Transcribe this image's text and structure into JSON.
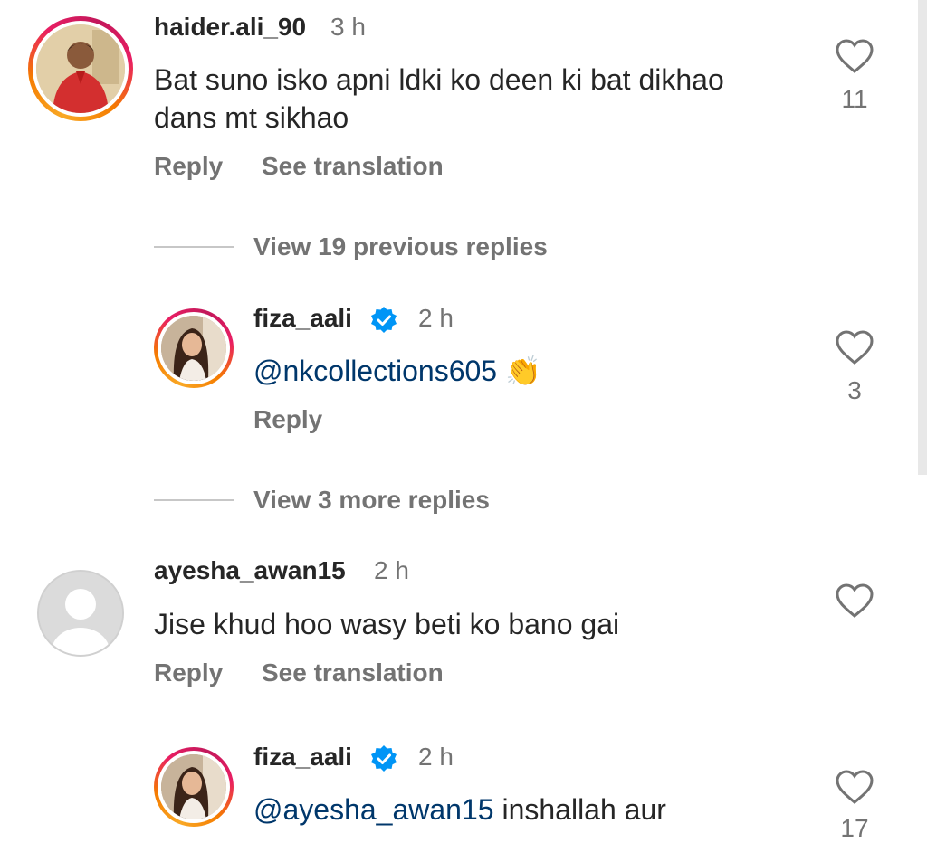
{
  "comments": [
    {
      "username": "haider.ali_90",
      "time": "3 h",
      "text_line1": "Bat suno isko apni ldki ko deen ki bat dikhao",
      "text_line2": "dans mt sikhao",
      "likes": "11",
      "reply_label": "Reply",
      "translate_label": "See translation"
    },
    {
      "view_replies_label": "View 19 previous replies"
    },
    {
      "username": "fiza_aali",
      "time": "2 h",
      "mention": "@nkcollections605",
      "emoji": "👏",
      "likes": "3",
      "reply_label": "Reply"
    },
    {
      "view_replies_label": "View 3 more replies"
    },
    {
      "username": "ayesha_awan15",
      "time": "2 h",
      "text": "Jise khud hoo wasy beti ko bano gai",
      "reply_label": "Reply",
      "translate_label": "See translation"
    },
    {
      "username": "fiza_aali",
      "time": "2 h",
      "mention": "@ayesha_awan15",
      "text": " inshallah aur",
      "likes": "17"
    }
  ],
  "icons": {
    "like": "heart-icon",
    "verified": "verified-badge-icon"
  },
  "colors": {
    "text": "#262626",
    "secondary": "#737373",
    "mention": "#00376b",
    "verified": "#0095f6"
  }
}
